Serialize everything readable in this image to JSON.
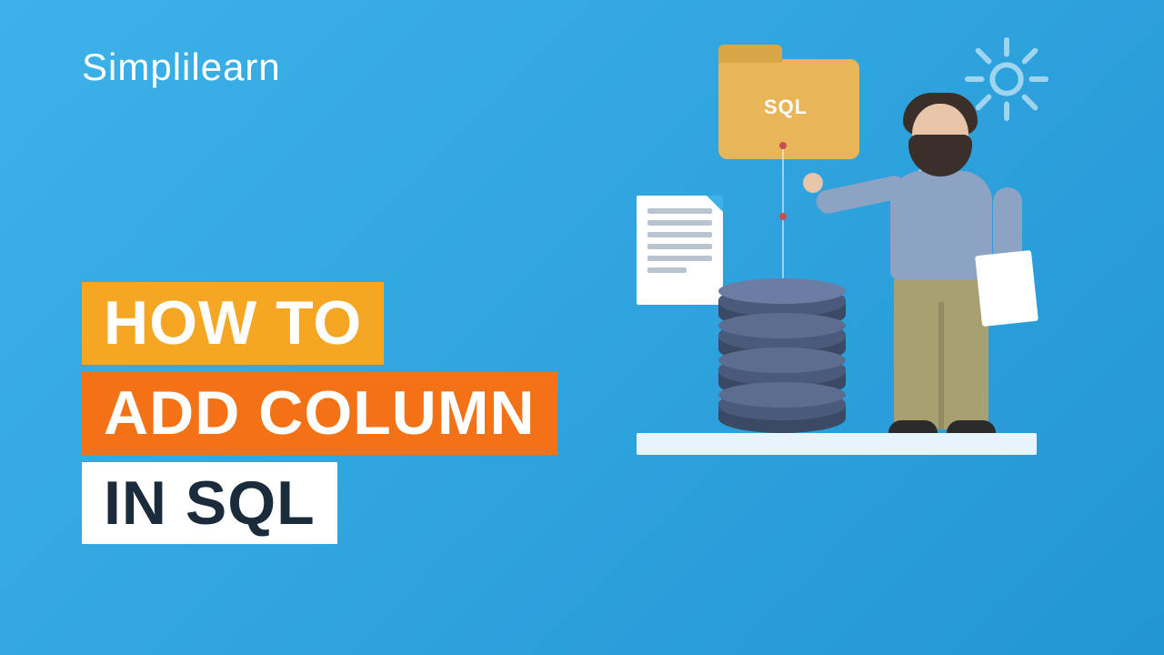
{
  "brand": {
    "name_part1": "Simpl",
    "name_part2": "i",
    "name_part3": "learn"
  },
  "title": {
    "line1": "HOW TO",
    "line2": "ADD COLUMN",
    "line3": "IN SQL"
  },
  "illustration": {
    "folder_label": "SQL"
  },
  "colors": {
    "bg_start": "#3db2e8",
    "bg_end": "#2196d4",
    "accent_yellow": "#f5a623",
    "accent_orange": "#f47216",
    "white": "#ffffff",
    "dark_text": "#1a2b3c"
  }
}
